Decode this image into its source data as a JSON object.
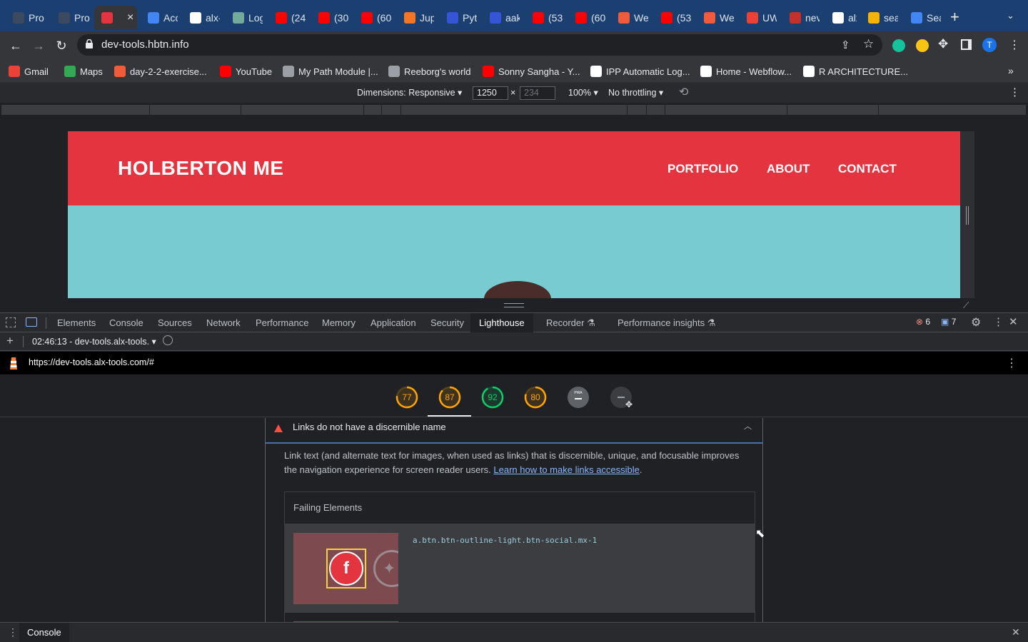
{
  "browser": {
    "tabs": [
      {
        "label": "Pro",
        "color": "#3c4a5f"
      },
      {
        "label": "Pro",
        "color": "#3c4a5f"
      },
      {
        "label": "",
        "color": "#e3343f",
        "active": true
      },
      {
        "label": "Acc",
        "color": "#4285f4"
      },
      {
        "label": "alx-",
        "color": "#ffffff"
      },
      {
        "label": "Log",
        "color": "#74aa9c"
      },
      {
        "label": "(24",
        "color": "#ff0000"
      },
      {
        "label": "(30",
        "color": "#ff0000"
      },
      {
        "label": "(60",
        "color": "#ff0000"
      },
      {
        "label": "Jup",
        "color": "#f37626"
      },
      {
        "label": "Pyt",
        "color": "#3456d6"
      },
      {
        "label": "aak",
        "color": "#3456d6"
      },
      {
        "label": "(53",
        "color": "#ff0000"
      },
      {
        "label": "(60",
        "color": "#ff0000"
      },
      {
        "label": "We",
        "color": "#ef5b3b"
      },
      {
        "label": "(53",
        "color": "#ff0000"
      },
      {
        "label": "We",
        "color": "#ef5b3b"
      },
      {
        "label": "UW",
        "color": "#ea4335"
      },
      {
        "label": "nev",
        "color": "#c4302b"
      },
      {
        "label": "alx-",
        "color": "#ffffff"
      },
      {
        "label": "sea",
        "color": "#f4b400"
      },
      {
        "label": "Sea",
        "color": "#4285f4"
      }
    ],
    "url": "dev-tools.hbtn.info",
    "bookmarks": [
      {
        "label": "Gmail",
        "color": "#ea4335"
      },
      {
        "label": "Maps",
        "color": "#34a853"
      },
      {
        "label": "day-2-2-exercise...",
        "color": "#ef5b3b"
      },
      {
        "label": "YouTube",
        "color": "#ff0000"
      },
      {
        "label": "My Path Module |...",
        "color": "#9aa0a6"
      },
      {
        "label": "Reeborg's world",
        "color": "#9aa0a6"
      },
      {
        "label": "Sonny Sangha - Y...",
        "color": "#ff0000"
      },
      {
        "label": "IPP Automatic Log...",
        "color": "#ffffff"
      },
      {
        "label": "Home - Webflow...",
        "color": "#ffffff"
      },
      {
        "label": "R ARCHITECTURE...",
        "color": "#ffffff"
      }
    ],
    "profile_initial": "T"
  },
  "device_toolbar": {
    "dimensions": "Dimensions: Responsive",
    "width": "1250",
    "height_placeholder": "234",
    "times": "×",
    "zoom": "100%",
    "throttling": "No throttling"
  },
  "site": {
    "brand": "HOLBERTON ME",
    "nav": [
      "PORTFOLIO",
      "ABOUT",
      "CONTACT"
    ],
    "header_color": "#e3343f",
    "hero_color": "#78ccd1"
  },
  "devtools": {
    "tabs": [
      "Elements",
      "Console",
      "Sources",
      "Network",
      "Performance",
      "Memory",
      "Application",
      "Security",
      "Lighthouse",
      "Recorder",
      "Performance insights"
    ],
    "active_tab": "Lighthouse",
    "errors": "6",
    "messages": "7",
    "report_label": "02:46:13 - dev-tools.alx-tools.",
    "report_url": "https://dev-tools.alx-tools.com/#",
    "scores": [
      {
        "value": 77,
        "color": "#ffa400"
      },
      {
        "value": 87,
        "color": "#ffa400"
      },
      {
        "value": 92,
        "color": "#0cce6b"
      },
      {
        "value": 80,
        "color": "#ffa400"
      }
    ],
    "pwa_label": "PWA",
    "audit": {
      "title": "Links do not have a discernible name",
      "description": "Link text (and alternate text for images, when used as links) that is discernible, unique, and focusable improves the navigation experience for screen reader users.",
      "link_text": "Learn how to make links accessible",
      "period": ".",
      "failing_header": "Failing Elements",
      "selector": "a.btn.btn-outline-light.btn-social.mx-1",
      "thumb_icon_f": "f"
    },
    "drawer_tab": "Console"
  }
}
